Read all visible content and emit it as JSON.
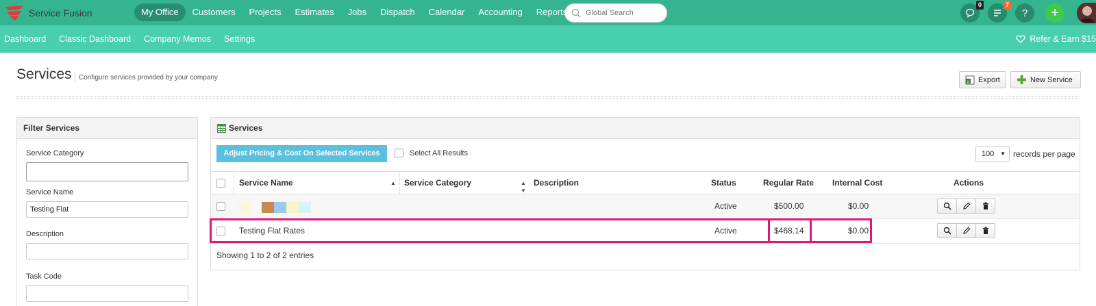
{
  "app": {
    "name": "Service Fusion"
  },
  "topnav": {
    "items": [
      {
        "label": "My Office",
        "active": true
      },
      {
        "label": "Customers"
      },
      {
        "label": "Projects"
      },
      {
        "label": "Estimates"
      },
      {
        "label": "Jobs"
      },
      {
        "label": "Dispatch"
      },
      {
        "label": "Calendar"
      },
      {
        "label": "Accounting"
      },
      {
        "label": "Reports"
      }
    ],
    "search_placeholder": "Global Search",
    "chat_count": "0",
    "notification_count": "7",
    "help_label": "?",
    "add_label": "+"
  },
  "subnav": {
    "items": [
      "Dashboard",
      "Classic Dashboard",
      "Company Memos",
      "Settings"
    ],
    "refer_label": "Refer & Earn $15"
  },
  "page": {
    "title": "Services",
    "subtitle": "Configure services provided by your company",
    "export_label": "Export",
    "new_service_label": "New Service"
  },
  "filter": {
    "title": "Filter Services",
    "fields": [
      {
        "label": "Service Category",
        "value": ""
      },
      {
        "label": "Service Name",
        "value": "Testing Flat"
      },
      {
        "label": "Description",
        "value": ""
      },
      {
        "label": "Task Code",
        "value": ""
      }
    ]
  },
  "services": {
    "title": "Services",
    "adjust_label": "Adjust Pricing & Cost On Selected Services",
    "select_all_label": "Select All Results",
    "per_page_value": "100",
    "per_page_label": "records per page",
    "columns": [
      "Service Name",
      "Service Category",
      "Description",
      "Status",
      "Regular Rate",
      "Internal Cost",
      "Actions"
    ],
    "rows": [
      {
        "name": "",
        "category": "",
        "description": "",
        "status": "Active",
        "regular_rate": "$500.00",
        "internal_cost": "$0.00"
      },
      {
        "name": "Testing Flat Rates",
        "category": "",
        "description": "",
        "status": "Active",
        "regular_rate": "$468.14",
        "internal_cost": "$0.00"
      }
    ],
    "showing_text": "Showing 1 to 2 of 2 entries"
  },
  "colors": {
    "topnav": "#34b58f",
    "subnav": "#49cfad",
    "adjust_button": "#5bc0de",
    "highlight": "#e3147a"
  }
}
